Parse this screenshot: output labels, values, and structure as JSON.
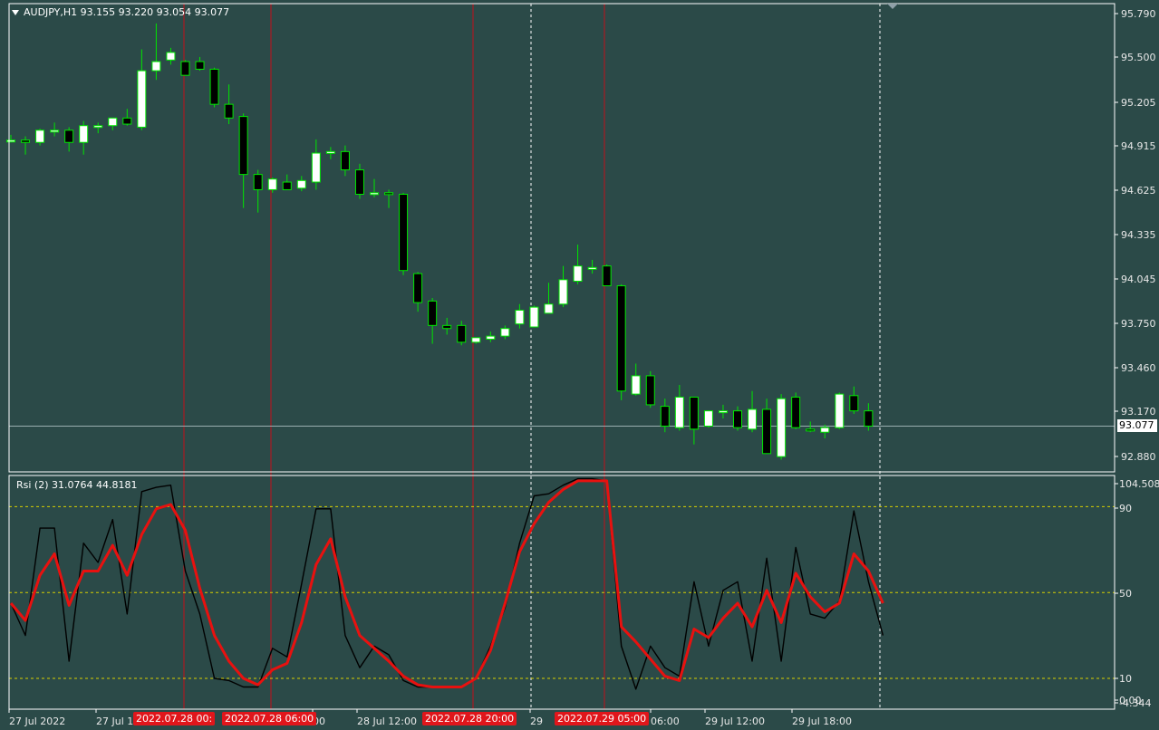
{
  "window": {
    "symbol_header": "AUDJPY,H1  93.155 93.220 93.054 93.077",
    "indicator_header": "Rsi (2) 31.0764 44.8181",
    "current_price": "93.077"
  },
  "colors": {
    "background": "#2b4a48",
    "bull_candle": "#ffffff",
    "bear_candle": "#000000",
    "wick": "#00e600",
    "rsi_fast": "#000000",
    "rsi_signal": "#e8110f",
    "level_line": "#d8d000",
    "vline_red": "#c0101a",
    "vline_white": "#ffffff"
  },
  "price_axis": [
    "95.790",
    "95.500",
    "95.205",
    "94.915",
    "94.625",
    "94.335",
    "94.045",
    "93.750",
    "93.460",
    "93.170",
    "92.880"
  ],
  "rsi_axis": [
    "104.508",
    "90",
    "50",
    "10",
    "0.00",
    "-4.344"
  ],
  "time_axis": [
    "27 Jul 2022",
    "27 Jul 1",
    "00",
    "28 Jul 12:00",
    "29",
    "06:00",
    "29 Jul 12:00",
    "29 Jul 18:00"
  ],
  "vline_labels": [
    "2022.07.28 00:",
    "2022.07.28 06:00",
    "2022.07.28 20:00",
    "2022.07.29 05:00"
  ],
  "chart_data": [
    {
      "type": "candlestick",
      "title": "AUDJPY,H1",
      "ylim": [
        92.78,
        95.85
      ],
      "candles": [
        {
          "o": 94.955,
          "h": 94.99,
          "l": 94.94,
          "c": 94.955
        },
        {
          "o": 94.955,
          "h": 94.98,
          "l": 94.86,
          "c": 94.94
        },
        {
          "o": 94.94,
          "h": 95.03,
          "l": 94.92,
          "c": 95.02
        },
        {
          "o": 95.02,
          "h": 95.07,
          "l": 94.98,
          "c": 95.02
        },
        {
          "o": 95.02,
          "h": 95.04,
          "l": 94.88,
          "c": 94.94
        },
        {
          "o": 94.94,
          "h": 95.08,
          "l": 94.86,
          "c": 95.05
        },
        {
          "o": 95.04,
          "h": 95.07,
          "l": 95.0,
          "c": 95.05
        },
        {
          "o": 95.05,
          "h": 95.1,
          "l": 95.02,
          "c": 95.1
        },
        {
          "o": 95.1,
          "h": 95.16,
          "l": 95.05,
          "c": 95.06
        },
        {
          "o": 95.04,
          "h": 95.55,
          "l": 95.02,
          "c": 95.41
        },
        {
          "o": 95.41,
          "h": 95.72,
          "l": 95.35,
          "c": 95.47
        },
        {
          "o": 95.48,
          "h": 95.56,
          "l": 95.45,
          "c": 95.53
        },
        {
          "o": 95.47,
          "h": 95.48,
          "l": 95.38,
          "c": 95.38
        },
        {
          "o": 95.47,
          "h": 95.5,
          "l": 95.41,
          "c": 95.42
        },
        {
          "o": 95.42,
          "h": 95.43,
          "l": 95.17,
          "c": 95.19
        },
        {
          "o": 95.19,
          "h": 95.32,
          "l": 95.06,
          "c": 95.1
        },
        {
          "o": 95.11,
          "h": 95.13,
          "l": 94.51,
          "c": 94.73
        },
        {
          "o": 94.73,
          "h": 94.76,
          "l": 94.48,
          "c": 94.63
        },
        {
          "o": 94.63,
          "h": 94.71,
          "l": 94.61,
          "c": 94.7
        },
        {
          "o": 94.68,
          "h": 94.73,
          "l": 94.63,
          "c": 94.63
        },
        {
          "o": 94.64,
          "h": 94.72,
          "l": 94.62,
          "c": 94.69
        },
        {
          "o": 94.68,
          "h": 94.96,
          "l": 94.63,
          "c": 94.87
        },
        {
          "o": 94.87,
          "h": 94.91,
          "l": 94.83,
          "c": 94.88
        },
        {
          "o": 94.88,
          "h": 94.92,
          "l": 94.72,
          "c": 94.76
        },
        {
          "o": 94.76,
          "h": 94.8,
          "l": 94.57,
          "c": 94.6
        },
        {
          "o": 94.6,
          "h": 94.7,
          "l": 94.58,
          "c": 94.61
        },
        {
          "o": 94.61,
          "h": 94.63,
          "l": 94.51,
          "c": 94.6
        },
        {
          "o": 94.6,
          "h": 94.61,
          "l": 94.07,
          "c": 94.1
        },
        {
          "o": 94.08,
          "h": 94.09,
          "l": 93.83,
          "c": 93.89
        },
        {
          "o": 93.9,
          "h": 93.92,
          "l": 93.62,
          "c": 93.74
        },
        {
          "o": 93.74,
          "h": 93.79,
          "l": 93.68,
          "c": 93.72
        },
        {
          "o": 93.74,
          "h": 93.77,
          "l": 93.61,
          "c": 93.63
        },
        {
          "o": 93.63,
          "h": 93.66,
          "l": 93.62,
          "c": 93.66
        },
        {
          "o": 93.65,
          "h": 93.7,
          "l": 93.63,
          "c": 93.67
        },
        {
          "o": 93.67,
          "h": 93.74,
          "l": 93.65,
          "c": 93.72
        },
        {
          "o": 93.75,
          "h": 93.88,
          "l": 93.72,
          "c": 93.84
        },
        {
          "o": 93.73,
          "h": 93.87,
          "l": 93.73,
          "c": 93.86
        },
        {
          "o": 93.82,
          "h": 94.02,
          "l": 93.82,
          "c": 93.88
        },
        {
          "o": 93.88,
          "h": 94.13,
          "l": 93.86,
          "c": 94.04
        },
        {
          "o": 94.03,
          "h": 94.27,
          "l": 94.01,
          "c": 94.13
        },
        {
          "o": 94.12,
          "h": 94.17,
          "l": 94.08,
          "c": 94.12
        },
        {
          "o": 94.13,
          "h": 94.14,
          "l": 94.0,
          "c": 94.0
        },
        {
          "o": 94.0,
          "h": 94.01,
          "l": 93.25,
          "c": 93.31
        },
        {
          "o": 93.29,
          "h": 93.49,
          "l": 93.28,
          "c": 93.41
        },
        {
          "o": 93.41,
          "h": 93.44,
          "l": 93.2,
          "c": 93.22
        },
        {
          "o": 93.21,
          "h": 93.26,
          "l": 93.04,
          "c": 93.08
        },
        {
          "o": 93.07,
          "h": 93.35,
          "l": 93.05,
          "c": 93.27
        },
        {
          "o": 93.27,
          "h": 93.27,
          "l": 92.96,
          "c": 93.06
        },
        {
          "o": 93.08,
          "h": 93.18,
          "l": 93.07,
          "c": 93.18
        },
        {
          "o": 93.17,
          "h": 93.22,
          "l": 93.13,
          "c": 93.18
        },
        {
          "o": 93.18,
          "h": 93.21,
          "l": 93.05,
          "c": 93.07
        },
        {
          "o": 93.06,
          "h": 93.31,
          "l": 93.04,
          "c": 93.19
        },
        {
          "o": 93.19,
          "h": 93.26,
          "l": 92.9,
          "c": 92.9
        },
        {
          "o": 92.88,
          "h": 93.29,
          "l": 92.86,
          "c": 93.26
        },
        {
          "o": 93.27,
          "h": 93.3,
          "l": 93.06,
          "c": 93.07
        },
        {
          "o": 93.06,
          "h": 93.11,
          "l": 93.04,
          "c": 93.05
        },
        {
          "o": 93.04,
          "h": 93.09,
          "l": 93.0,
          "c": 93.07
        },
        {
          "o": 93.07,
          "h": 93.3,
          "l": 93.06,
          "c": 93.29
        },
        {
          "o": 93.28,
          "h": 93.34,
          "l": 93.16,
          "c": 93.18
        },
        {
          "o": 93.18,
          "h": 93.23,
          "l": 93.05,
          "c": 93.08
        }
      ]
    },
    {
      "type": "line",
      "title": "Rsi (2)",
      "ylim": [
        -4.344,
        104.508
      ],
      "levels": [
        10,
        50,
        90
      ],
      "series": [
        {
          "values": [
            45,
            30,
            80,
            80,
            18,
            73,
            64,
            84,
            40,
            97,
            99,
            100,
            60,
            40,
            10,
            9,
            6,
            6,
            24,
            20,
            54,
            89,
            89,
            30,
            15,
            25,
            21,
            9,
            6,
            6,
            6,
            6,
            10,
            25,
            43,
            73,
            95,
            96,
            100,
            103,
            103,
            102,
            25,
            5,
            25,
            15,
            11,
            55,
            25,
            51,
            55,
            18,
            66,
            18,
            71,
            40,
            38,
            46,
            88,
            55,
            30
          ]
        },
        {
          "values": [
            45,
            37,
            58,
            68,
            44,
            60,
            60,
            72,
            58,
            77,
            89,
            91,
            79,
            52,
            30,
            18,
            10,
            7,
            14,
            17,
            36,
            63,
            75,
            48,
            30,
            24,
            18,
            11,
            7,
            6,
            6,
            6,
            10,
            23,
            45,
            69,
            82,
            92,
            98,
            102,
            102,
            102,
            34,
            27,
            19,
            11,
            9,
            33,
            29,
            38,
            45,
            34,
            51,
            36,
            59,
            48,
            41,
            45,
            68,
            60,
            45
          ]
        }
      ]
    }
  ]
}
